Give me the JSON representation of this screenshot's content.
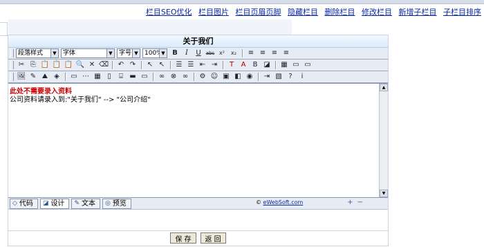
{
  "nav_links": [
    "栏目SEO优化",
    "栏目图片",
    "栏目页眉页脚",
    "隐藏栏目",
    "删除栏目",
    "修改栏目",
    "新增子栏目",
    "子栏目排序"
  ],
  "panel": {
    "title": "关于我们"
  },
  "toolbar": {
    "paragraph_style": "段落样式",
    "font_family": "字体",
    "font_size": "字号",
    "zoom": "100%",
    "row1_buttons": [
      "B",
      "I",
      "U",
      "abc",
      "x²",
      "x₂",
      "≡",
      "≡",
      "≡",
      "≡"
    ],
    "row2_buttons": [
      "✂",
      "⎘",
      "📋",
      "📋",
      "📋",
      "🔍",
      "✕",
      "⌫",
      "↶",
      "↷",
      "↖",
      "↖",
      "☰",
      "☰",
      "⇤",
      "⇥",
      "T",
      "A",
      "B",
      "◪",
      "▦",
      "▭",
      "▭"
    ],
    "row3_buttons": [
      "🖼",
      "✎",
      "⛰",
      "◈",
      "▭",
      "⋯",
      "▦",
      "▯",
      "⌸",
      "▬",
      "▭",
      "∞",
      "⊗",
      "∞",
      "⚙",
      "☺",
      "▣",
      "◧",
      "◉",
      "⇥",
      "▧",
      "?",
      "i"
    ]
  },
  "editor": {
    "warning": "此处不需要录入资料",
    "instruction": "公司资料请录入到:\"关于我们\"  -->  \"公司介绍\""
  },
  "modes": [
    {
      "label": "代码",
      "icon": "◇",
      "active": false
    },
    {
      "label": "设计",
      "icon": "◪",
      "active": true
    },
    {
      "label": "文本",
      "icon": "✎",
      "active": false
    },
    {
      "label": "预览",
      "icon": "◎",
      "active": false
    }
  ],
  "copyright": {
    "symbol": "©",
    "link": "eWebSoft.com"
  },
  "zoom_controls": [
    "+",
    "−"
  ],
  "actions": {
    "save": "保 存",
    "back": "返 回"
  }
}
